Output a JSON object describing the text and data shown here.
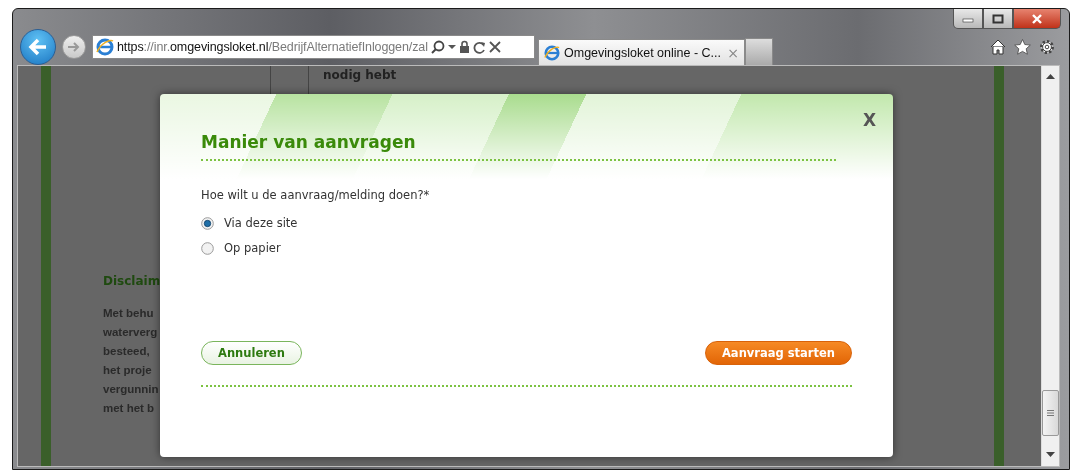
{
  "browser": {
    "address": [
      {
        "text": "https",
        "emphasis": true
      },
      {
        "text": "://inr.",
        "emphasis": false
      },
      {
        "text": "omgevingsloket.nl",
        "emphasis": true
      },
      {
        "text": "/BedrijfAlternatiefInloggen/zal",
        "emphasis": false
      }
    ],
    "tabs": [
      {
        "title": "Omgevingsloket online - C...",
        "selected": true,
        "close": "×"
      }
    ]
  },
  "page": {
    "header_text": "nodig hebt",
    "disclaimer_title": "Disclaim",
    "disclaimer_lines": [
      "Met behu",
      "waterverg",
      "besteed, ",
      "het proje",
      "vergunnin",
      "met het b"
    ]
  },
  "dialog": {
    "title": "Manier van aanvragen",
    "close": "X",
    "question": "Hoe wilt u de aanvraag/melding doen?*",
    "options": [
      {
        "label": "Via deze site",
        "selected": true
      },
      {
        "label": "Op papier",
        "selected": false
      }
    ],
    "buttons": [
      {
        "label": "Annuleren",
        "kind": "secondary"
      },
      {
        "label": "Aanvraag starten",
        "kind": "primary"
      }
    ]
  }
}
